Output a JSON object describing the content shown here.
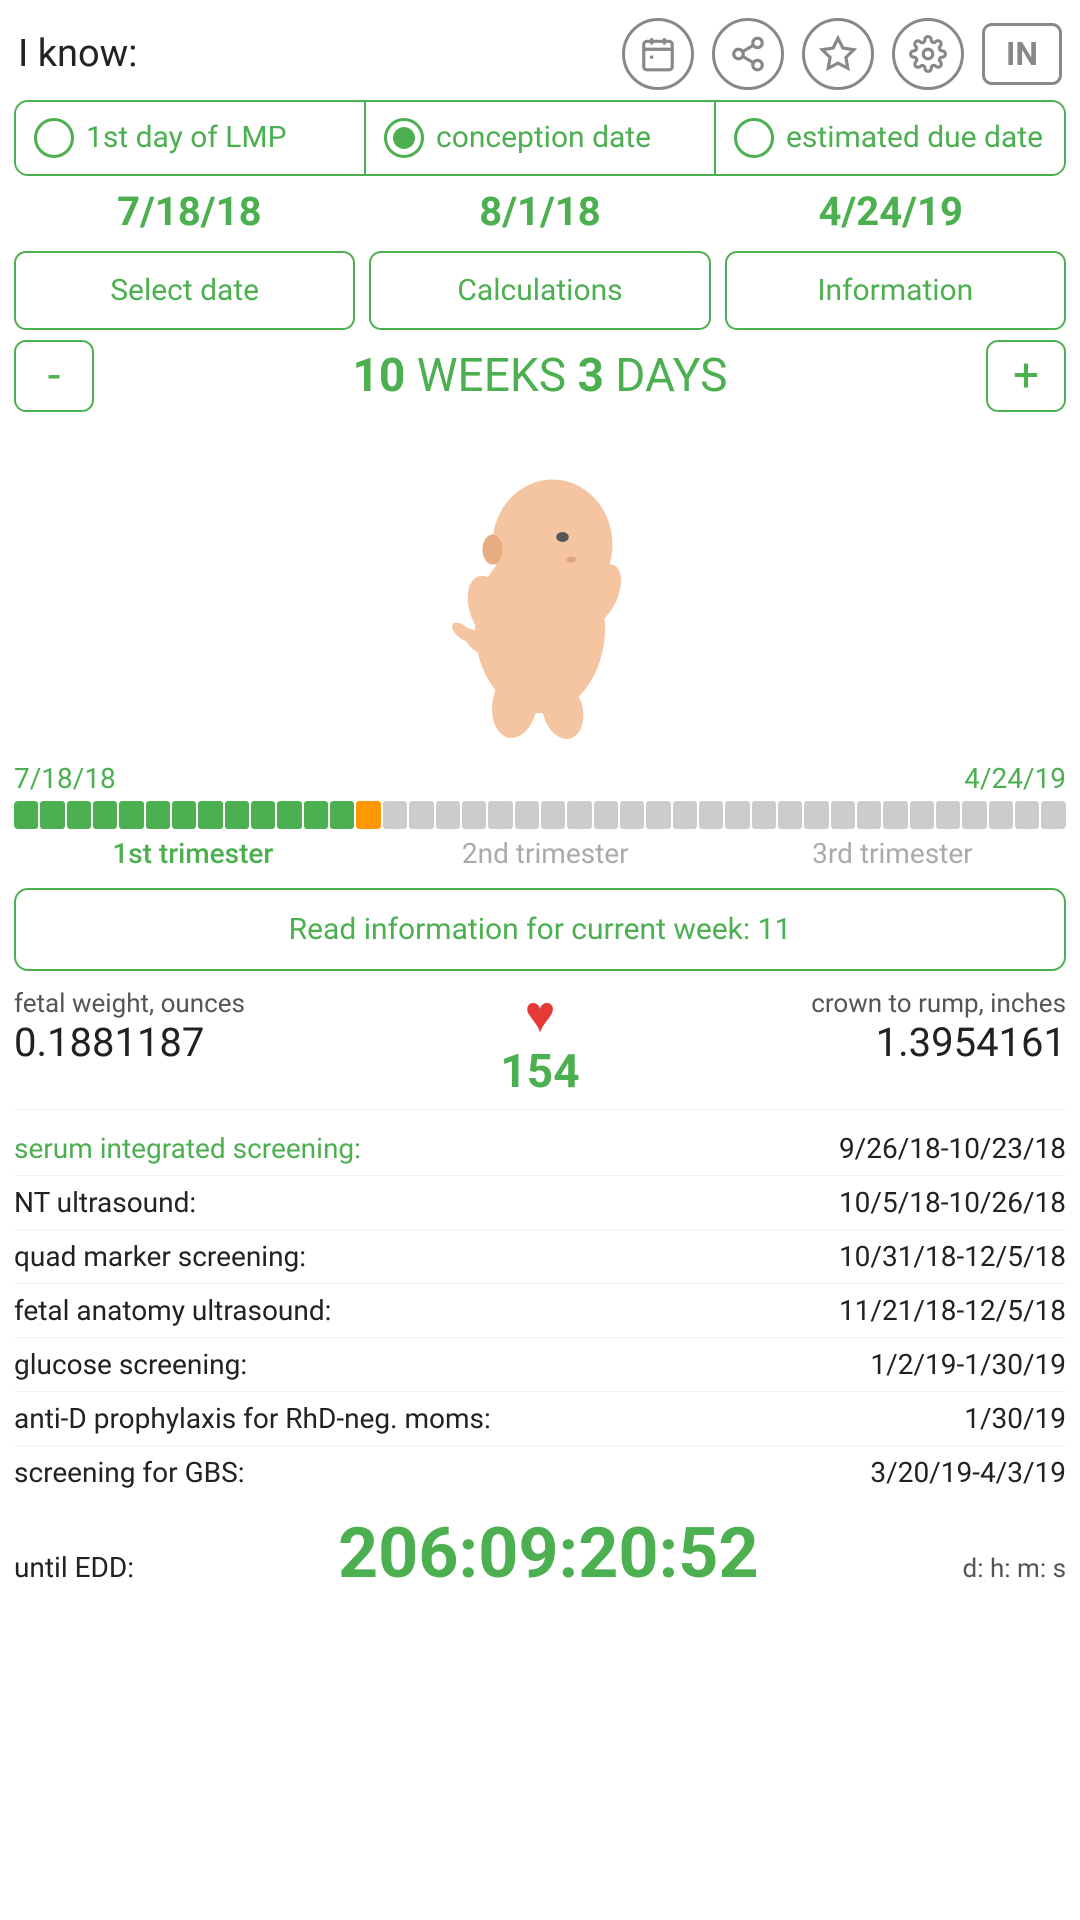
{
  "topBar": {
    "iKnowLabel": "I know:",
    "icons": [
      "calendar-icon",
      "share-icon",
      "star-icon",
      "settings-icon"
    ],
    "inButton": "IN"
  },
  "radioRow": {
    "options": [
      {
        "label": "1st day of LMP",
        "selected": false
      },
      {
        "label": "conception date",
        "selected": true
      },
      {
        "label": "estimated due date",
        "selected": false
      }
    ]
  },
  "dates": {
    "lmp": "7/18/18",
    "conception": "8/1/18",
    "edd": "4/24/19"
  },
  "actionButtons": {
    "selectDate": "Select date",
    "calculations": "Calculations",
    "information": "Information"
  },
  "weeks": {
    "minus": "-",
    "plus": "+",
    "display": "10 WEEKS 3 DAYS",
    "weeks": "10",
    "days": "3"
  },
  "progressBar": {
    "startDate": "7/18/18",
    "endDate": "4/24/19",
    "greenSegments": 13,
    "orangeSegments": 1,
    "graySegments": 26,
    "trimesterLabels": [
      "1st trimester",
      "2nd trimester",
      "3rd trimester"
    ],
    "trim1Width": "34",
    "trim2Width": "33",
    "trim3Width": "33"
  },
  "infoBox": {
    "text": "Read information for current week: 11"
  },
  "stats": {
    "fetalWeightLabel": "fetal weight, ounces",
    "fetalWeightValue": "0.1881187",
    "heartCount": "154",
    "crownLabel": "crown to rump, inches",
    "crownValue": "1.3954161"
  },
  "medicalRows": [
    {
      "label": "serum integrated screening:",
      "date": "9/26/18-10/23/18",
      "green": true
    },
    {
      "label": "NT ultrasound:",
      "date": "10/5/18-10/26/18",
      "green": false
    },
    {
      "label": "quad marker screening:",
      "date": "10/31/18-12/5/18",
      "green": false
    },
    {
      "label": "fetal anatomy ultrasound:",
      "date": "11/21/18-12/5/18",
      "green": false
    },
    {
      "label": "glucose screening:",
      "date": "1/2/19-1/30/19",
      "green": false
    },
    {
      "label": "anti-D prophylaxis for RhD-neg. moms:",
      "date": "1/30/19",
      "green": false
    },
    {
      "label": "screening for GBS:",
      "date": "3/20/19-4/3/19",
      "green": false
    }
  ],
  "countdown": {
    "label": "until EDD:",
    "time": "206:09:20:52",
    "units": "d: h: m: s"
  }
}
